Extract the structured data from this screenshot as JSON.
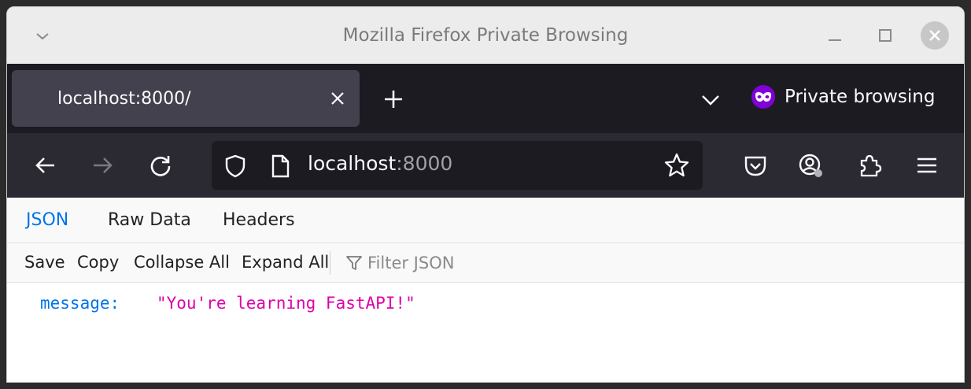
{
  "window": {
    "title": "Mozilla Firefox Private Browsing"
  },
  "tabs": [
    {
      "label": "localhost:8000/",
      "active": true
    }
  ],
  "private_label": "Private browsing",
  "url": {
    "host": "localhost",
    "port": ":8000"
  },
  "viewer_tabs": {
    "json": "JSON",
    "raw": "Raw Data",
    "headers": "Headers"
  },
  "toolbar": {
    "save": "Save",
    "copy": "Copy",
    "collapse": "Collapse All",
    "expand": "Expand All",
    "filter_placeholder": "Filter JSON"
  },
  "json": {
    "key": "message:",
    "value": "\"You're learning FastAPI!\""
  },
  "colors": {
    "accent": "#0074e8",
    "string": "#dd00a9",
    "private": "#8000d7"
  }
}
